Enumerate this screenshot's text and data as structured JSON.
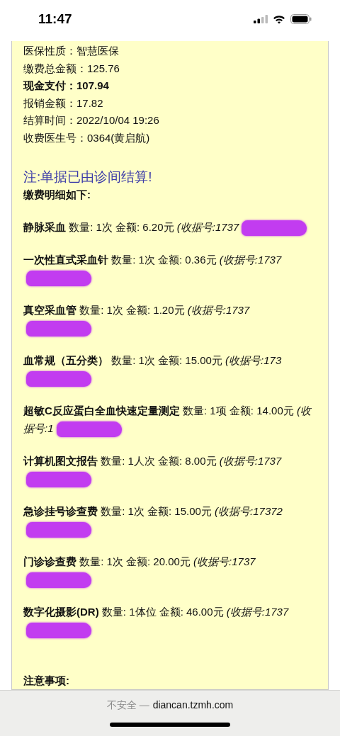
{
  "status_bar": {
    "time": "11:47"
  },
  "summary": [
    {
      "text": "医保性质：智慧医保",
      "bold": false
    },
    {
      "text": "缴费总金额：125.76",
      "bold": false
    },
    {
      "text": "现金支付：107.94",
      "bold": true
    },
    {
      "text": "报销金额：17.82",
      "bold": false
    },
    {
      "text": "结算时间：2022/10/04 19:26",
      "bold": false
    },
    {
      "text": "收费医生号：0364(黄启航)",
      "bold": false
    }
  ],
  "notice": "注:单据已由诊间结算!",
  "details_heading": "缴费明细如下:",
  "items": [
    {
      "text": "**静脉采血** 数量: 1次 金额: 6.20元 *(收据号:1737*",
      "redacted": true
    },
    {
      "text": "**一次性直式采血针** 数量: 1次 金额: 0.36元 *(收据号:1737*",
      "redacted": true
    },
    {
      "text": "**真空采血管** 数量: 1次 金额: 1.20元 *(收据号:1737*",
      "redacted": true
    },
    {
      "text": "**血常规（五分类）** 数量: 1次 金额: 15.00元 *(收据号:173*",
      "redacted": true
    },
    {
      "text": "**超敏C反应蛋白全血快速定量测定** 数量: 1项 金额: 14.00元 *(收据号:1*",
      "redacted": true
    },
    {
      "text": "**计算机图文报告** 数量: 1人次 金额: 8.00元 *(收据号:1737*",
      "redacted": true
    },
    {
      "text": "**急诊挂号诊查费** 数量: 1次 金额: 15.00元 *(收据号:17372*",
      "redacted": true
    },
    {
      "text": "**门诊诊查费** 数量: 1次 金额: 20.00元 *(收据号:1737*",
      "redacted": true
    },
    {
      "text": "**数字化摄影(DR)** 数量: 1体位 金额: 46.00元 *(收据号:1737*",
      "redacted": true
    }
  ],
  "notes_heading": "注意事项:",
  "address_bar": {
    "security": "不安全 —",
    "url": "diancan.tzmh.com"
  }
}
